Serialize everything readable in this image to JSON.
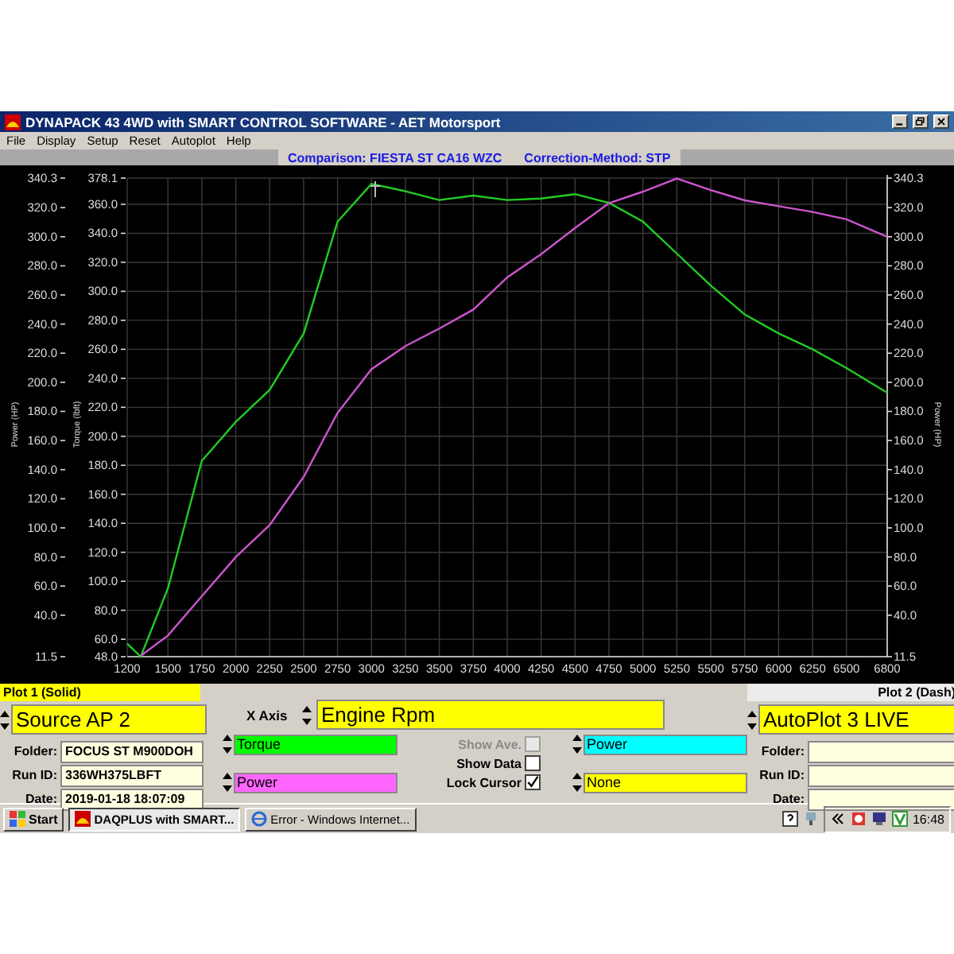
{
  "window": {
    "title": "DYNAPACK 43 4WD with SMART CONTROL SOFTWARE - AET Motorsport"
  },
  "menu": [
    "File",
    "Display",
    "Setup",
    "Reset",
    "Autoplot",
    "Help"
  ],
  "comparison": {
    "title": "Comparison: FIESTA ST CA16 WZC",
    "correction": "Correction-Method: STP"
  },
  "chart": {
    "axis_titles": {
      "left_power": "Power (HP)",
      "left_torque": "Torque (lbft)",
      "right_power": "Power (HP)"
    },
    "left_power_ticks": [
      "340.3",
      "320.0",
      "300.0",
      "280.0",
      "260.0",
      "240.0",
      "220.0",
      "200.0",
      "180.0",
      "160.0",
      "140.0",
      "120.0",
      "100.0",
      "80.0",
      "60.0",
      "40.0",
      "11.5"
    ],
    "chart_data": {
      "type": "line",
      "x": [
        1200,
        1300,
        1500,
        1750,
        2000,
        2250,
        2500,
        2750,
        3000,
        3250,
        3500,
        3750,
        4000,
        4250,
        4500,
        4750,
        5000,
        5250,
        5500,
        5750,
        6000,
        6250,
        6500,
        6800
      ],
      "series": [
        {
          "name": "Torque",
          "color": "#22cc22",
          "values": [
            57,
            48,
            95,
            183,
            210,
            232,
            271,
            348,
            374,
            369,
            363,
            366,
            363,
            364,
            367,
            361,
            348,
            326,
            304,
            284,
            271,
            260,
            247,
            230
          ]
        },
        {
          "name": "Power",
          "color": "#cc55cc",
          "axis": "y2",
          "values": [
            null,
            12,
            26,
            53,
            80,
            102,
            135,
            179,
            209,
            225,
            237,
            250,
            272,
            288,
            306,
            323,
            331,
            340,
            332,
            325,
            321,
            317,
            312,
            300
          ]
        }
      ],
      "grid": true,
      "xlim": [
        1200,
        6800
      ],
      "xticks": [
        1200,
        1500,
        1750,
        2000,
        2250,
        2500,
        2750,
        3000,
        3250,
        3500,
        3750,
        4000,
        4250,
        4500,
        4750,
        5000,
        5250,
        5500,
        5750,
        6000,
        6250,
        6500,
        6800
      ],
      "ylim": [
        48,
        378.1
      ],
      "yticks": [
        {
          "value": 48,
          "label": "48.0"
        },
        {
          "value": 60,
          "label": "60.0"
        },
        {
          "value": 80,
          "label": "80.0"
        },
        {
          "value": 100,
          "label": "100.0"
        },
        {
          "value": 120,
          "label": "120.0"
        },
        {
          "value": 140,
          "label": "140.0"
        },
        {
          "value": 160,
          "label": "160.0"
        },
        {
          "value": 180,
          "label": "180.0"
        },
        {
          "value": 200,
          "label": "200.0"
        },
        {
          "value": 220,
          "label": "220.0"
        },
        {
          "value": 240,
          "label": "240.0"
        },
        {
          "value": 260,
          "label": "260.0"
        },
        {
          "value": 280,
          "label": "280.0"
        },
        {
          "value": 300,
          "label": "300.0"
        },
        {
          "value": 320,
          "label": "320.0"
        },
        {
          "value": 340,
          "label": "340.0"
        },
        {
          "value": 360,
          "label": "360.0"
        },
        {
          "value": 378.1,
          "label": "378.1"
        }
      ],
      "y2lim": [
        11.5,
        340.3
      ],
      "y2ticks": [
        {
          "value": 11.5,
          "label": "11.5"
        },
        {
          "value": 40,
          "label": "40.0"
        },
        {
          "value": 60,
          "label": "60.0"
        },
        {
          "value": 80,
          "label": "80.0"
        },
        {
          "value": 100,
          "label": "100.0"
        },
        {
          "value": 120,
          "label": "120.0"
        },
        {
          "value": 140,
          "label": "140.0"
        },
        {
          "value": 160,
          "label": "160.0"
        },
        {
          "value": 180,
          "label": "180.0"
        },
        {
          "value": 200,
          "label": "200.0"
        },
        {
          "value": 220,
          "label": "220.0"
        },
        {
          "value": 240,
          "label": "240.0"
        },
        {
          "value": 260,
          "label": "260.0"
        },
        {
          "value": 280,
          "label": "280.0"
        },
        {
          "value": 300,
          "label": "300.0"
        },
        {
          "value": 320,
          "label": "320.0"
        },
        {
          "value": 340.3,
          "label": "340.3"
        }
      ]
    }
  },
  "plot1": {
    "header": "Plot 1 (Solid)",
    "source": "Source AP 2",
    "fields": [
      {
        "label": "Folder:",
        "value": "FOCUS ST M900DOH"
      },
      {
        "label": "Run ID:",
        "value": "336WH375LBFT"
      },
      {
        "label": "Date:",
        "value": "2019-01-18 18:07:09"
      }
    ]
  },
  "x_axis": {
    "label": "X Axis",
    "value": "Engine Rpm"
  },
  "plot1_channels": [
    {
      "color": "#00ff00"
    },
    {
      "color": "#ff66ff"
    }
  ],
  "checkboxes": [
    {
      "label": "Show Ave.",
      "checked": false,
      "disabled": true
    },
    {
      "label": "Show Data",
      "checked": false,
      "disabled": false
    },
    {
      "label": "Lock Cursor",
      "checked": true,
      "disabled": false
    }
  ],
  "plot2_channels": [
    {
      "value": "Power",
      "color": "#00ffff"
    },
    {
      "value": "None",
      "color": "#ffff00"
    }
  ],
  "plot2": {
    "header": "Plot 2 (Dash)",
    "source": "AutoPlot 3 LIVE",
    "fields": [
      {
        "label": "Folder:"
      },
      {
        "label": "Run ID:"
      },
      {
        "label": "Date:"
      }
    ]
  },
  "taskbar": {
    "start": "Start",
    "tasks": [
      {
        "label": "DAQPLUS with SMART...",
        "selected": true
      },
      {
        "label": "Error - Windows Internet...",
        "selected": false
      }
    ],
    "clock": "16:48"
  }
}
